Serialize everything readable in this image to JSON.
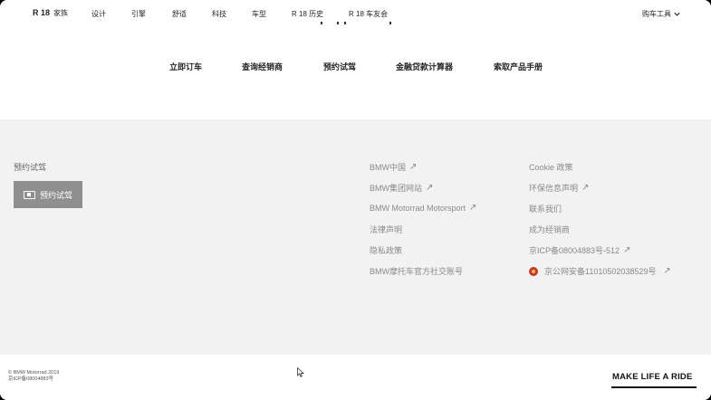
{
  "nav": {
    "brand_model": "R 18",
    "brand_sub": "家族",
    "items": [
      "设计",
      "引擎",
      "舒适",
      "科技",
      "车型",
      "R 18 历史",
      "R 18 车友会"
    ],
    "tools_label": "购车工具"
  },
  "actions": [
    "立即订车",
    "查询经销商",
    "预约试驾",
    "金融贷款计算器",
    "索取产品手册"
  ],
  "footer": {
    "test_ride_title": "预约试驾",
    "test_ride_button": "预约试驾",
    "col1": [
      "BMW中国",
      "BMW集团网站",
      "BMW Motorrad Motorsport",
      "法律声明",
      "隐私政策",
      "BMW摩托车官方社交账号"
    ],
    "col2": [
      "Cookie 政策",
      "环保信息声明",
      "联系我们",
      "成为经销商",
      "京ICP备08004883号-512",
      "京公网安备11010502038529号"
    ]
  },
  "bottom": {
    "copyright": "© BMW Motorrad 2019",
    "icp": "京ICP备08004883号",
    "slogan": "MAKE LIFE A RIDE"
  },
  "colors": {
    "footer_bg": "#f2f2f2",
    "button_bg": "#8f8f8f",
    "text_dark": "#262626",
    "text_muted": "#8a8a8a"
  },
  "icons": {
    "tools_chevron": "chevron-down-icon",
    "external_link": "arrow-up-right-icon",
    "test_ride_icon": "motorbike-wheel-icon",
    "police_badge": "police-badge-icon"
  }
}
